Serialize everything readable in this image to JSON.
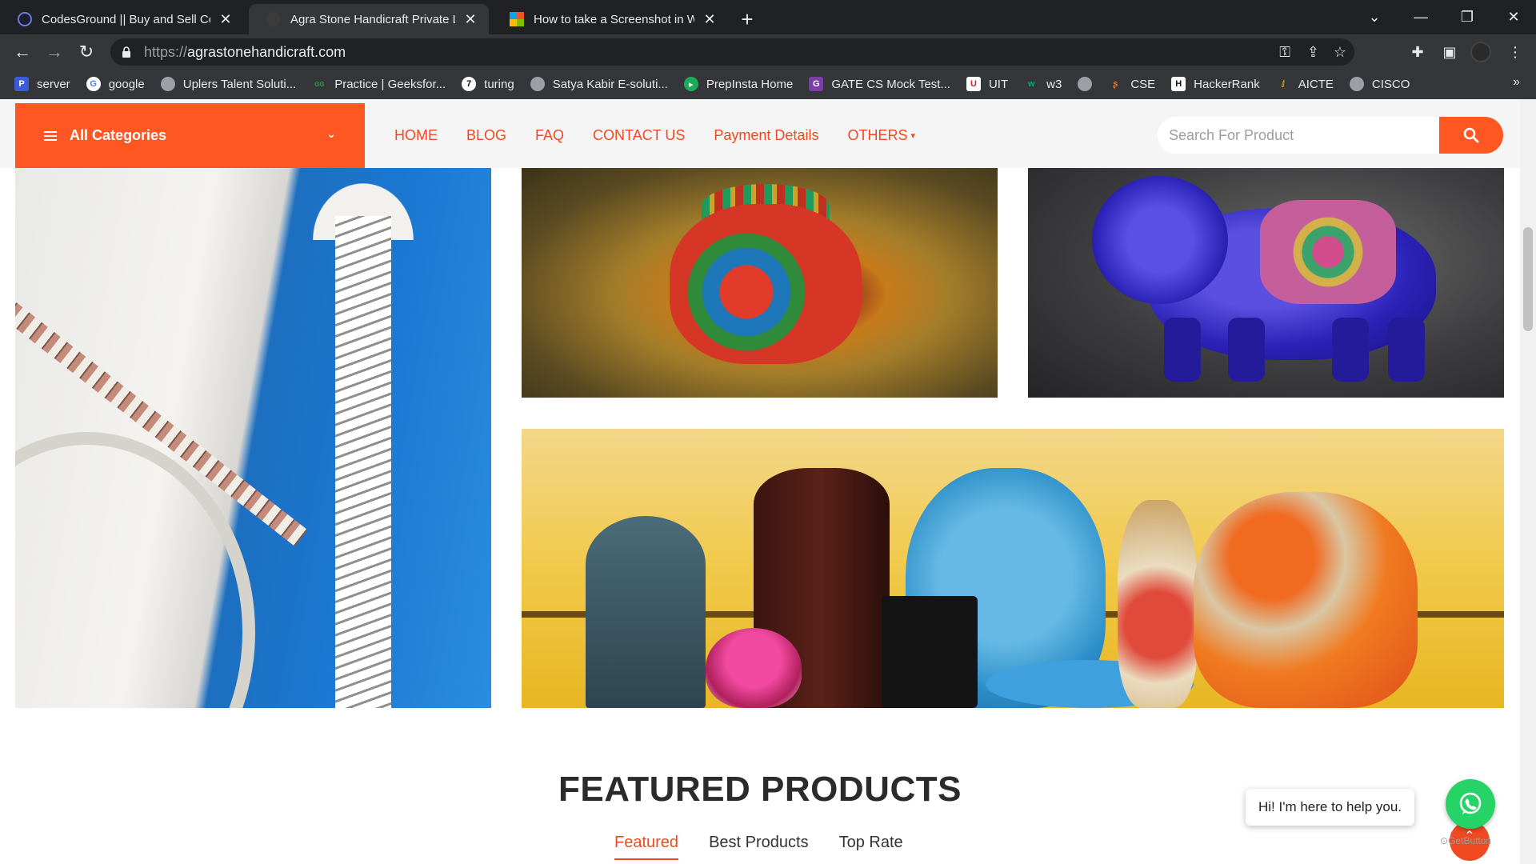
{
  "browser": {
    "tabs": [
      {
        "title": "CodesGround || Buy and Sell Cod",
        "active": false
      },
      {
        "title": "Agra Stone Handicraft Private Lin",
        "active": true
      },
      {
        "title": "How to take a Screenshot in Win",
        "active": false
      }
    ],
    "url_scheme": "https://",
    "url_host": "agrastonehandicraft.com",
    "bookmarks": [
      {
        "label": "server",
        "icon": "p-icon",
        "color": "#3b5bdb"
      },
      {
        "label": "google",
        "icon": "google-icon",
        "color": "#ffffff"
      },
      {
        "label": "Uplers Talent Soluti...",
        "icon": "globe-icon",
        "color": "#9aa0a6"
      },
      {
        "label": "Practice | Geeksfor...",
        "icon": "gfg-icon",
        "color": "#2f8d46"
      },
      {
        "label": "turing",
        "icon": "turing-icon",
        "color": "#111111"
      },
      {
        "label": "Satya Kabir E-soluti...",
        "icon": "globe-icon",
        "color": "#9aa0a6"
      },
      {
        "label": "PrepInsta Home",
        "icon": "prepinsta-icon",
        "color": "#1faa59"
      },
      {
        "label": "GATE CS Mock Test...",
        "icon": "gate-icon",
        "color": "#7b3fa8"
      },
      {
        "label": "UIT",
        "icon": "uit-icon",
        "color": "#c62828"
      },
      {
        "label": "w3",
        "icon": "w3-icon",
        "color": "#04aa6d"
      },
      {
        "label": "",
        "icon": "globe-icon",
        "color": "#9aa0a6"
      },
      {
        "label": "CSE",
        "icon": "cse-icon",
        "color": "#e67e22"
      },
      {
        "label": "HackerRank",
        "icon": "hackerrank-icon",
        "color": "#00c853"
      },
      {
        "label": "AICTE",
        "icon": "aicte-icon",
        "color": "#1e40af"
      },
      {
        "label": "CISCO",
        "icon": "globe-icon",
        "color": "#9aa0a6"
      }
    ],
    "bookmarks_more": "»"
  },
  "site": {
    "all_categories": "All Categories",
    "menu": [
      "HOME",
      "BLOG",
      "FAQ",
      "CONTACT US",
      "Payment Details",
      "OTHERS"
    ],
    "search_placeholder": "Search For Product",
    "accent": "#ff5722"
  },
  "featured": {
    "title": "FEATURED PRODUCTS",
    "tabs": [
      "Featured",
      "Best Products",
      "Top Rate"
    ],
    "active_tab": 0
  },
  "chat": {
    "bubble": "Hi! I'm here to help you.",
    "powered": "GetButton"
  }
}
